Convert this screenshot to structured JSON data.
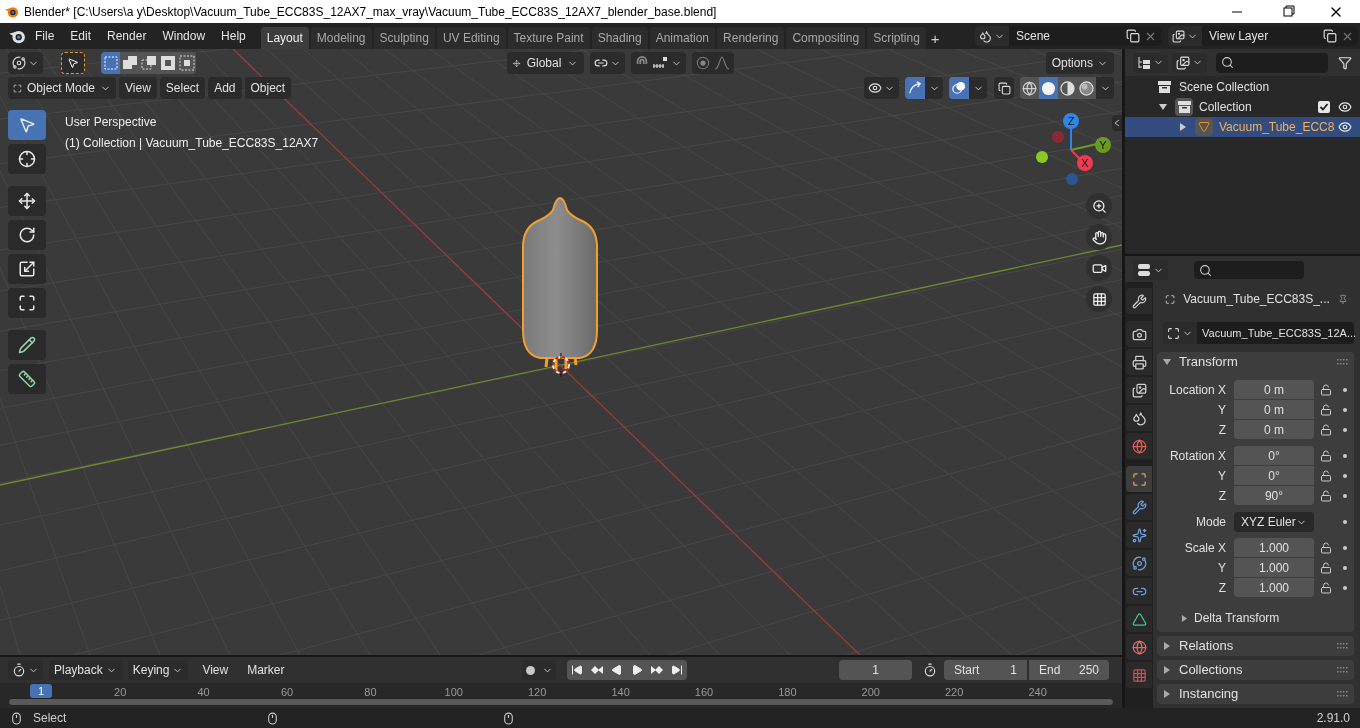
{
  "window": {
    "title": "Blender* [C:\\Users\\a y\\Desktop\\Vacuum_Tube_ECC83S_12AX7_max_vray\\Vacuum_Tube_ECC83S_12AX7_blender_base.blend]"
  },
  "menu": [
    "File",
    "Edit",
    "Render",
    "Window",
    "Help"
  ],
  "workspace_tabs": [
    {
      "label": "Layout",
      "selected": true
    },
    {
      "label": "Modeling",
      "selected": false
    },
    {
      "label": "Sculpting",
      "selected": false
    },
    {
      "label": "UV Editing",
      "selected": false
    },
    {
      "label": "Texture Paint",
      "selected": false
    },
    {
      "label": "Shading",
      "selected": false
    },
    {
      "label": "Animation",
      "selected": false
    },
    {
      "label": "Rendering",
      "selected": false
    },
    {
      "label": "Compositing",
      "selected": false
    },
    {
      "label": "Scripting",
      "selected": false
    }
  ],
  "add_workspace": "+",
  "scene": {
    "value": "Scene"
  },
  "view_layer": {
    "value": "View Layer"
  },
  "viewport": {
    "select_modes": [
      {
        "selected": true
      },
      {
        "selected": false
      },
      {
        "selected": false
      },
      {
        "selected": false
      },
      {
        "selected": false
      }
    ],
    "transform_orientation": "Global",
    "options": "Options",
    "mode": "Object Mode",
    "menus": [
      "View",
      "Select",
      "Add",
      "Object"
    ],
    "gizmo_toggle": true,
    "overlay_toggle": true,
    "shading": [
      {
        "kind": "wireframe",
        "selected": false
      },
      {
        "kind": "solid",
        "selected": true
      },
      {
        "kind": "material",
        "selected": false
      },
      {
        "kind": "rendered",
        "selected": false
      }
    ],
    "tools": [
      {
        "kind": "select",
        "selected": true
      },
      {
        "kind": "cursor",
        "selected": false
      },
      {
        "kind": "move",
        "selected": false
      },
      {
        "kind": "rotate",
        "selected": false
      },
      {
        "kind": "scale",
        "selected": false
      },
      {
        "kind": "transform",
        "selected": false
      },
      {
        "kind": "annotate",
        "selected": false
      },
      {
        "kind": "measure",
        "selected": false
      }
    ],
    "view_name": "User Perspective",
    "view_info": "(1) Collection | Vacuum_Tube_ECC83S_12AX7",
    "gizmo_axes": [
      {
        "label": "Z",
        "color": "#2e86e8"
      },
      {
        "label": "Y",
        "color": "#6b9a22"
      },
      {
        "label": "X",
        "color": "#ef3a50"
      }
    ]
  },
  "outliner": {
    "items": [
      {
        "label": "Scene Collection",
        "selected": false,
        "children": [
          {
            "label": "Collection",
            "selected": false,
            "expanded": true,
            "checked": true,
            "visible": true,
            "children": [
              {
                "label": "Vacuum_Tube_ECC8",
                "selected": true,
                "expanded": false,
                "visible": true
              }
            ]
          }
        ]
      }
    ]
  },
  "properties": {
    "tabs": [
      {
        "kind": "tool",
        "selected": false
      },
      {
        "kind": "render",
        "selected": false
      },
      {
        "kind": "output",
        "selected": false
      },
      {
        "kind": "view_layer",
        "selected": false
      },
      {
        "kind": "scene",
        "selected": false
      },
      {
        "kind": "world",
        "selected": false
      },
      {
        "kind": "object",
        "selected": true
      },
      {
        "kind": "modifiers",
        "selected": false
      },
      {
        "kind": "particles",
        "selected": false
      },
      {
        "kind": "physics",
        "selected": false
      },
      {
        "kind": "constraints",
        "selected": false
      },
      {
        "kind": "data",
        "selected": false
      },
      {
        "kind": "material",
        "selected": false
      },
      {
        "kind": "texture",
        "selected": false
      }
    ],
    "object_name": "Vacuum_Tube_ECC83S_...",
    "datablock": "Vacuum_Tube_ECC83S_12A...",
    "panels": [
      {
        "label": "Transform",
        "expanded": true,
        "groups": [
          {
            "kind": "vector",
            "rows": [
              {
                "label": "Location X",
                "value": "0 m",
                "locked": false
              },
              {
                "label": "Y",
                "value": "0 m",
                "locked": false
              },
              {
                "label": "Z",
                "value": "0 m",
                "locked": false
              }
            ]
          },
          {
            "kind": "vector",
            "rows": [
              {
                "label": "Rotation X",
                "value": "0°",
                "locked": false
              },
              {
                "label": "Y",
                "value": "0°",
                "locked": false
              },
              {
                "label": "Z",
                "value": "90°",
                "locked": false
              }
            ]
          },
          {
            "kind": "dropdown",
            "label": "Mode",
            "value": "XYZ Euler"
          },
          {
            "kind": "vector",
            "rows": [
              {
                "label": "Scale X",
                "value": "1.000",
                "locked": false
              },
              {
                "label": "Y",
                "value": "1.000",
                "locked": false
              },
              {
                "label": "Z",
                "value": "1.000",
                "locked": false
              }
            ]
          }
        ],
        "subpanels": [
          {
            "label": "Delta Transform",
            "expanded": false
          }
        ]
      },
      {
        "label": "Relations",
        "expanded": false
      },
      {
        "label": "Collections",
        "expanded": false
      },
      {
        "label": "Instancing",
        "expanded": false
      }
    ]
  },
  "timeline": {
    "menus": [
      "Playback",
      "Keying",
      "View",
      "Marker"
    ],
    "auto_keying": false,
    "current_frame": "1",
    "start_label": "Start",
    "start": "1",
    "end_label": "End",
    "end": "250",
    "playhead": "1",
    "ticks": [
      "20",
      "40",
      "60",
      "80",
      "100",
      "120",
      "140",
      "160",
      "180",
      "200",
      "220",
      "240"
    ]
  },
  "status_bar": {
    "action": "Select",
    "version": "2.91.0"
  }
}
